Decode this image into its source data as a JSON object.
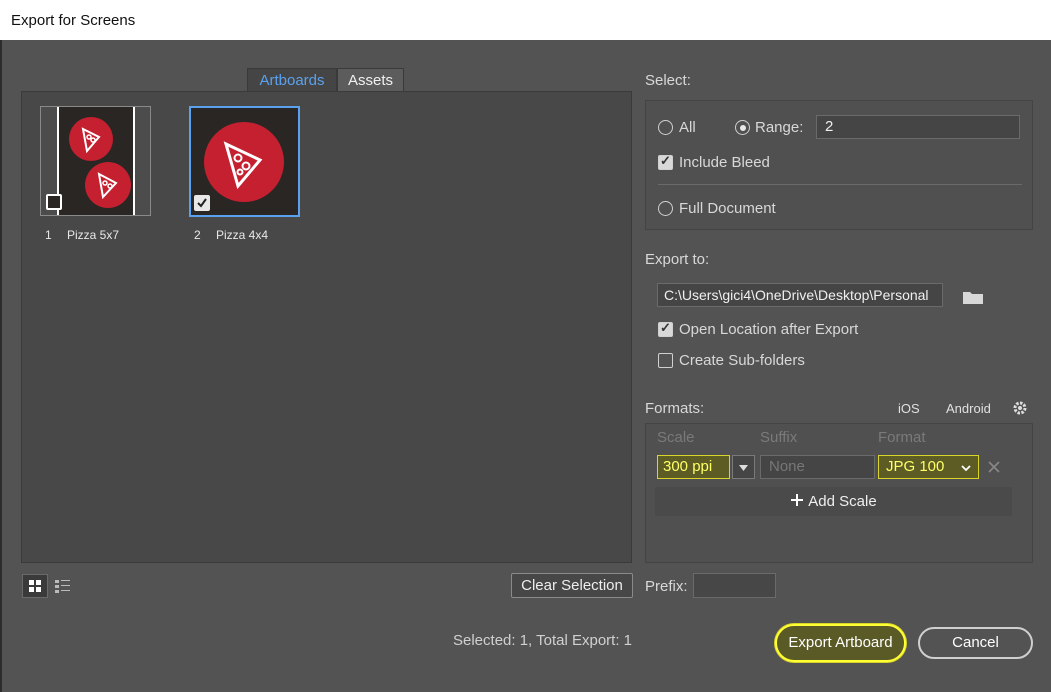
{
  "window": {
    "title": "Export for Screens"
  },
  "tabs": [
    {
      "label": "Artboards"
    },
    {
      "label": "Assets"
    }
  ],
  "artboards": [
    {
      "number": "1",
      "name": "Pizza 5x7",
      "checked": false
    },
    {
      "number": "2",
      "name": "Pizza 4x4",
      "checked": true
    }
  ],
  "left_footer": {
    "clear_selection_label": "Clear Selection"
  },
  "select_section": {
    "heading": "Select:",
    "all_label": "All",
    "range_label": "Range:",
    "range_value": "2",
    "include_bleed_label": "Include Bleed",
    "full_document_label": "Full Document"
  },
  "export_to": {
    "heading": "Export to:",
    "path": "C:\\Users\\gici4\\OneDrive\\Desktop\\Personal",
    "open_location_label": "Open Location after Export",
    "create_subfolders_label": "Create Sub-folders"
  },
  "formats": {
    "heading": "Formats:",
    "ios_label": "iOS",
    "android_label": "Android",
    "columns": {
      "scale": "Scale",
      "suffix": "Suffix",
      "format": "Format"
    },
    "row": {
      "scale": "300 ppi",
      "suffix_placeholder": "None",
      "format": "JPG 100"
    },
    "add_scale_label": "Add Scale"
  },
  "prefix": {
    "label": "Prefix:"
  },
  "status": {
    "text": "Selected: 1, Total Export: 1"
  },
  "buttons": {
    "export_label": "Export Artboard",
    "cancel_label": "Cancel"
  },
  "colors": {
    "accent": "#5aa2ef",
    "highlight": "#ffff33",
    "pizza_red": "#c42030"
  }
}
